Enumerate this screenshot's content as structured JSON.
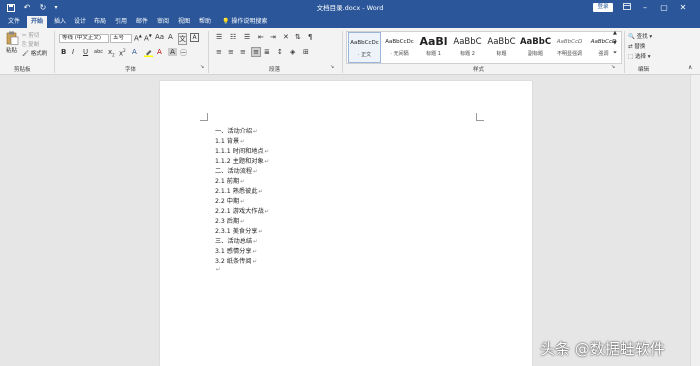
{
  "window": {
    "title": "文档目录.docx  -  Word",
    "login_label": "登录"
  },
  "quick_access": {
    "save_icon": "save-icon",
    "undo_icon": "undo-icon",
    "redo_icon": "redo-icon"
  },
  "tabs": [
    "文件",
    "开始",
    "插入",
    "设计",
    "布局",
    "引用",
    "邮件",
    "审阅",
    "视图",
    "帮助"
  ],
  "tell_me": "操作说明搜索",
  "clipboard": {
    "paste": "粘贴",
    "cut": "剪切",
    "copy": "复制",
    "format_painter": "格式刷",
    "label": "剪贴板"
  },
  "font": {
    "name": "等线 (中文正文)",
    "size": "五号",
    "label": "字体"
  },
  "paragraph": {
    "label": "段落"
  },
  "styles": {
    "label": "样式",
    "items": [
      {
        "sample": "AaBbCcDc",
        "name": "· 正文"
      },
      {
        "sample": "AaBbCcDc",
        "name": "· 无间隔"
      },
      {
        "sample": "AaBl",
        "name": "标题 1"
      },
      {
        "sample": "AaBbC",
        "name": "标题 2"
      },
      {
        "sample": "AaBbC",
        "name": "标题"
      },
      {
        "sample": "AaBbC",
        "name": "副标题"
      },
      {
        "sample": "AaBbCcD",
        "name": "不明显强调"
      },
      {
        "sample": "AaBbCcD",
        "name": "强调"
      }
    ]
  },
  "editing": {
    "find": "查找",
    "replace": "替换",
    "select": "选择",
    "label": "编辑"
  },
  "document": {
    "lines": [
      "一、活动介绍",
      "1.1 背景",
      "1.1.1 时间和地点",
      "1.1.2 主题和对象",
      "二、活动流程",
      "2.1 前期",
      "2.1.1 熟悉彼此",
      "2.2 中期",
      "2.2.1 游戏大作战",
      "2.3 后期",
      "2.3.1 美食分享",
      "三、活动总结",
      "3.1 感情分享",
      "3.2 纸条传阅"
    ],
    "paragraph_mark": "↵"
  },
  "watermark": "头条 @数据蛙软件"
}
